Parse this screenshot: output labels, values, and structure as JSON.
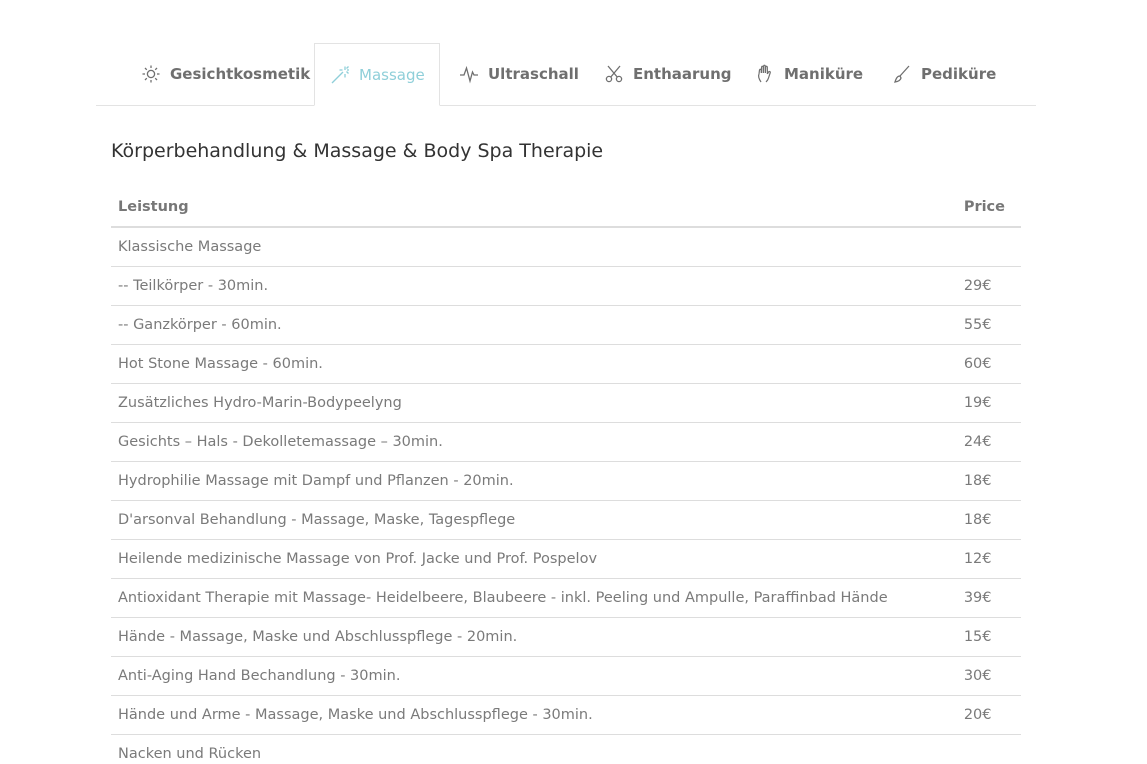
{
  "tabs": [
    {
      "label": "Gesichtkosmetik",
      "icon": "sun-icon",
      "active": false
    },
    {
      "label": "Massage",
      "icon": "magic-wand-icon",
      "active": true
    },
    {
      "label": "Ultraschall",
      "icon": "pulse-icon",
      "active": false
    },
    {
      "label": "Enthaarung",
      "icon": "scissors-icon",
      "active": false
    },
    {
      "label": "Maniküre",
      "icon": "hand-icon",
      "active": false
    },
    {
      "label": "Pediküre",
      "icon": "brush-icon",
      "active": false
    }
  ],
  "colors": {
    "accent": "#8fcfd9",
    "text": "#777777",
    "heading": "#333333",
    "border": "#dddddd"
  },
  "section": {
    "title": "Körperbehandlung & Massage & Body Spa Therapie"
  },
  "table": {
    "headers": {
      "service": "Leistung",
      "price": "Price"
    },
    "rows": [
      {
        "service": "Klassische Massage",
        "price": ""
      },
      {
        "service": "-- Teilkörper - 30min.",
        "price": "29€"
      },
      {
        "service": "-- Ganzkörper - 60min.",
        "price": "55€"
      },
      {
        "service": "Hot Stone Massage - 60min.",
        "price": "60€"
      },
      {
        "service": "Zusätzliches Hydro-Marin-Bodypeelyng",
        "price": "19€"
      },
      {
        "service": "Gesichts – Hals - Dekolletemassage – 30min.",
        "price": "24€"
      },
      {
        "service": "Hydrophilie Massage mit Dampf und Pflanzen - 20min.",
        "price": "18€"
      },
      {
        "service": "D'arsonval Behandlung - Massage, Maske, Tagespflege",
        "price": "18€"
      },
      {
        "service": "Heilende medizinische Massage von Prof. Jacke und Prof. Pospelov",
        "price": "12€"
      },
      {
        "service": "Antioxidant Therapie mit Massage- Heidelbeere, Blaubeere - inkl. Peeling und Ampulle, Paraffinbad Hände",
        "price": "39€"
      },
      {
        "service": "Hände - Massage, Maske und Abschlusspflege - 20min.",
        "price": "15€"
      },
      {
        "service": "Anti-Aging Hand Bechandlung - 30min.",
        "price": "30€"
      },
      {
        "service": "Hände und Arme - Massage, Maske und Abschlusspflege - 30min.",
        "price": "20€"
      },
      {
        "service": "Nacken und Rücken",
        "price": ""
      }
    ]
  }
}
